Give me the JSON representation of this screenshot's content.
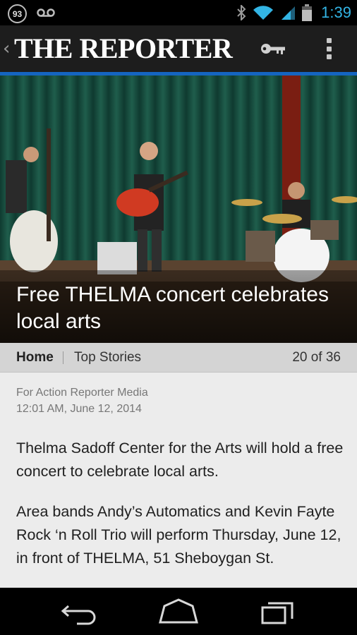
{
  "status_bar": {
    "notification_count": "93",
    "clock": "1:39",
    "icons": [
      "voicemail-icon",
      "bluetooth-icon",
      "wifi-icon",
      "signal-icon",
      "battery-icon"
    ],
    "clock_color": "#33b5e5"
  },
  "app_bar": {
    "masthead": "THE REPORTER",
    "up_icon": "chevron-left-icon",
    "actions": [
      "key-icon",
      "overflow-menu-icon"
    ],
    "accent_color": "#1565c0"
  },
  "hero": {
    "headline": "Free THELMA concert celebrates local arts"
  },
  "nav": {
    "home": "Home",
    "section": "Top Stories",
    "counter": "20 of 36"
  },
  "article": {
    "byline": "For Action Reporter Media",
    "timestamp": "12:01 AM, June 12, 2014",
    "paragraphs": [
      "Thelma Sadoff Center for the Arts will hold a free concert to celebrate local arts.",
      "Area bands Andy’s Automatics and Kevin Fayte Rock ‘n Roll Trio will perform Thursday, June 12, in front of THELMA, 51 Sheboygan St."
    ]
  },
  "system_nav": {
    "buttons": [
      "back-icon",
      "home-icon",
      "recents-icon"
    ]
  }
}
